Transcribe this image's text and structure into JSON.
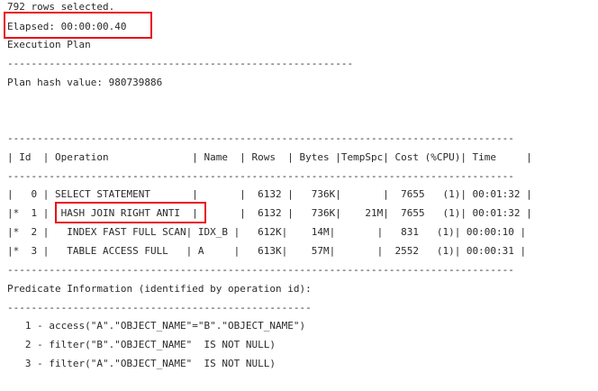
{
  "output": {
    "rows_selected": "792 rows selected.",
    "elapsed": "Elapsed: 00:00:00.40",
    "execution_plan_title": "Execution Plan",
    "title_rule": "----------------------------------------------------------",
    "plan_hash": "Plan hash value: 980739886",
    "table_rule": "-------------------------------------------------------------------------------------",
    "table_header": "| Id  | Operation              | Name  | Rows  | Bytes |TempSpc| Cost (%CPU)| Time     |",
    "table_rows": [
      "|   0 | SELECT STATEMENT       |       |  6132 |   736K|       |  7655   (1)| 00:01:32 |",
      "|*  1 |  HASH JOIN RIGHT ANTI  |       |  6132 |   736K|    21M|  7655   (1)| 00:01:32 |",
      "|*  2 |   INDEX FAST FULL SCAN| IDX_B |   612K|    14M|       |   831   (1)| 00:00:10 |",
      "|*  3 |   TABLE ACCESS FULL   | A     |   613K|    57M|       |  2552   (1)| 00:00:31 |"
    ],
    "predicate_title": "Predicate Information (identified by operation id):",
    "predicate_rule": "---------------------------------------------------",
    "predicates": [
      "   1 - access(\"A\".\"OBJECT_NAME\"=\"B\".\"OBJECT_NAME\")",
      "   2 - filter(\"B\".\"OBJECT_NAME\"  IS NOT NULL)",
      "   3 - filter(\"A\".\"OBJECT_NAME\"  IS NOT NULL)"
    ]
  },
  "highlight_color": "#e8101a"
}
